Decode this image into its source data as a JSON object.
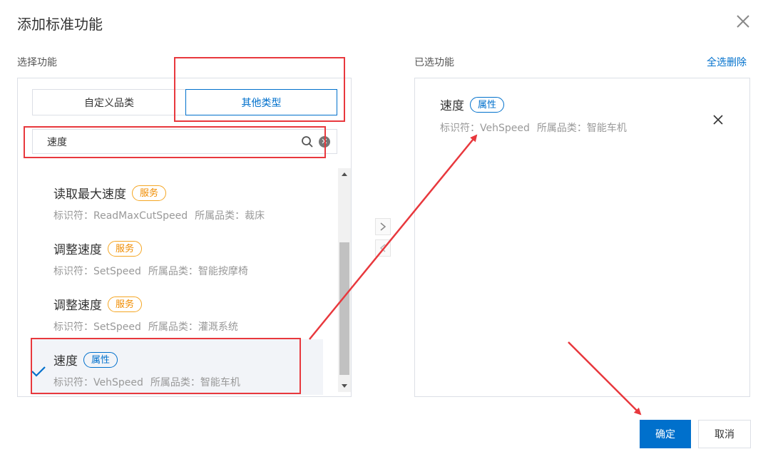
{
  "dialog": {
    "title": "添加标准功能"
  },
  "left": {
    "section_label": "选择功能",
    "tabs": [
      {
        "label": "自定义品类",
        "active": false
      },
      {
        "label": "其他类型",
        "active": true
      }
    ],
    "search": {
      "value": "速度",
      "placeholder": ""
    },
    "items": [
      {
        "name": "读取最大速度",
        "badge": "服务",
        "meta_id_label": "标识符：ReadMaxCutSpeed",
        "meta_cat_label": "所属品类：裁床",
        "selected": false
      },
      {
        "name": "调整速度",
        "badge": "服务",
        "meta_id_label": "标识符：SetSpeed",
        "meta_cat_label": "所属品类：智能按摩椅",
        "selected": false
      },
      {
        "name": "调整速度",
        "badge": "服务",
        "meta_id_label": "标识符：SetSpeed",
        "meta_cat_label": "所属品类：灌溉系统",
        "selected": false
      },
      {
        "name": "速度",
        "badge": "属性",
        "meta_id_label": "标识符：VehSpeed",
        "meta_cat_label": "所属品类：智能车机",
        "selected": true
      }
    ]
  },
  "right": {
    "section_label": "已选功能",
    "select_all_delete": "全选删除",
    "items": [
      {
        "name": "速度",
        "badge": "属性",
        "meta_id_label": "标识符：VehSpeed",
        "meta_cat_label": "所属品类：智能车机"
      }
    ]
  },
  "footer": {
    "confirm_label": "确定",
    "cancel_label": "取消"
  },
  "colors": {
    "primary": "#0070cc",
    "service_badge": "#f08c00",
    "highlight_annotation": "#e8383d"
  }
}
